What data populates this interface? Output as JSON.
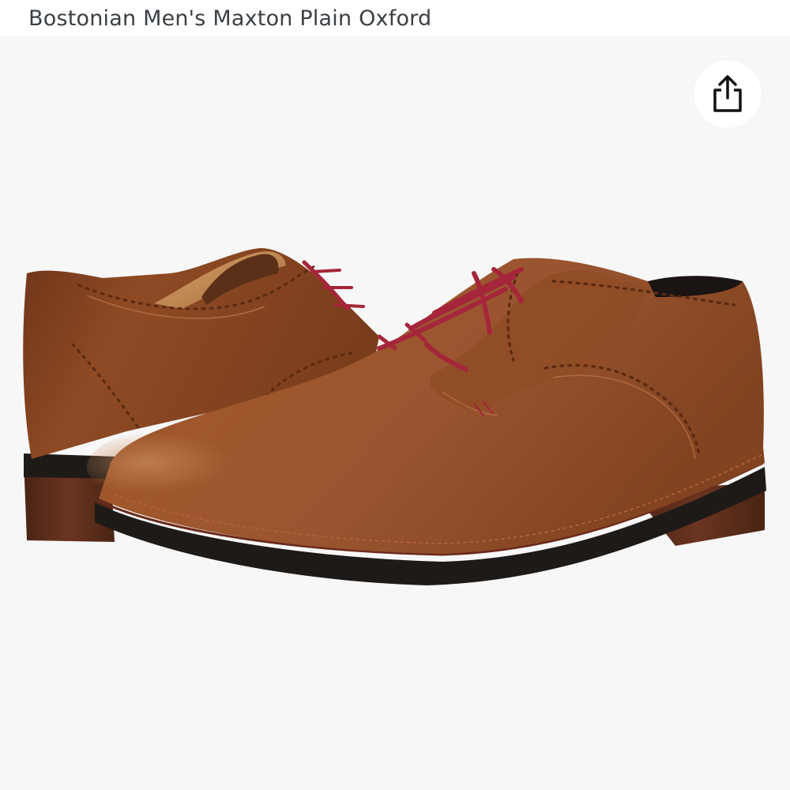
{
  "product": {
    "title": "Bostonian Men's Maxton Plain Oxford"
  },
  "image": {
    "subject": "pair of brown leather plain-toe oxford shoes with red laces",
    "colors": {
      "background": "#f7f7f7",
      "leather": "#8a4a24",
      "leather_light": "#b0683a",
      "sole": "#1e1a18",
      "heel": "#5a2c1a",
      "laces": "#a5263a"
    }
  },
  "actions": {
    "share_icon": "share-icon"
  }
}
